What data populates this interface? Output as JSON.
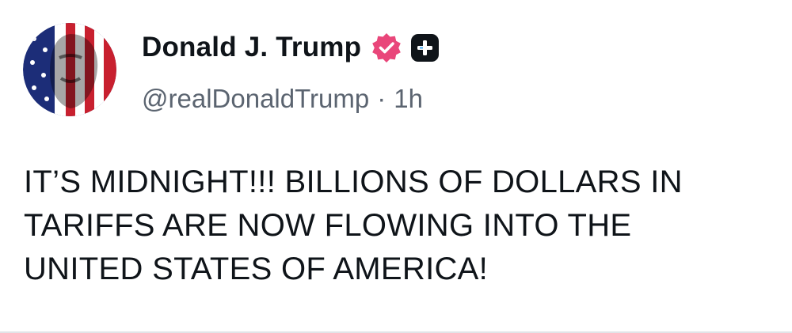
{
  "post": {
    "author": {
      "display_name": "Donald J. Trump",
      "handle": "@realDonaldTrump",
      "separator": "·",
      "time_ago": "1h",
      "avatar_icon": "profile-avatar",
      "verified_icon": "verified-badge-icon",
      "badge_icon": "plus-badge-icon"
    },
    "content": "IT’S MIDNIGHT!!! BILLIONS OF DOLLARS IN\nTARIFFS ARE NOW FLOWING INTO THE\nUNITED STATES OF AMERICA!"
  },
  "colors": {
    "text": "#0f1419",
    "secondary_text": "#5b6470",
    "verified_badge": "#e9467a",
    "plus_badge": "#0f1419"
  }
}
